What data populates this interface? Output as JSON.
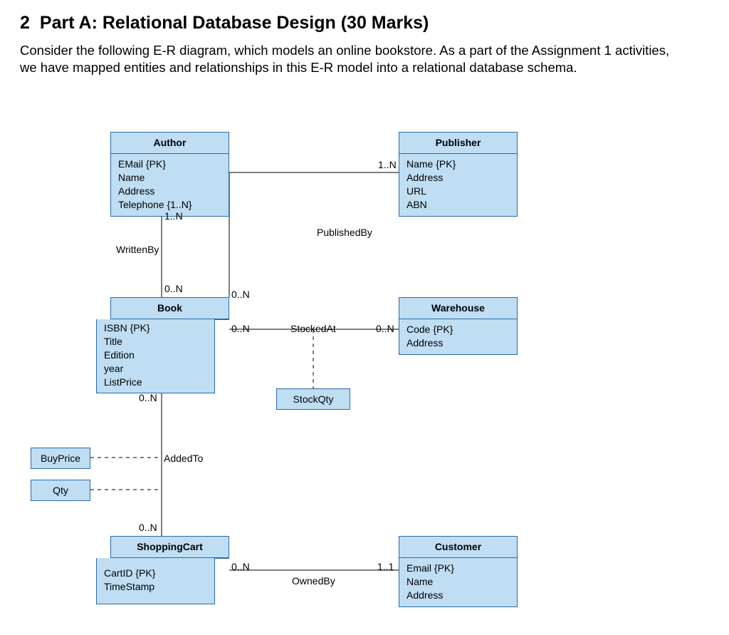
{
  "heading": {
    "number": "2",
    "title": "Part A: Relational Database Design (30 Marks)"
  },
  "intro": "Consider the following E-R diagram, which models an online bookstore. As a part of the Assignment 1 activities, we have mapped entities and relationships in this E-R model into a relational database schema.",
  "entities": {
    "author": {
      "name": "Author",
      "attrs": [
        "EMail {PK}",
        "Name",
        "Address",
        "Telephone {1..N}"
      ]
    },
    "publisher": {
      "name": "Publisher",
      "attrs": [
        "Name {PK}",
        "Address",
        "URL",
        "ABN"
      ]
    },
    "book": {
      "name": "Book",
      "attrs": [
        "ISBN {PK}",
        "Title",
        "Edition",
        "year",
        "ListPrice"
      ]
    },
    "warehouse": {
      "name": "Warehouse",
      "attrs": [
        "Code {PK}",
        "Address"
      ]
    },
    "cart": {
      "name": "ShoppingCart",
      "attrs": [
        "CartID {PK}",
        "TimeStamp"
      ]
    },
    "customer": {
      "name": "Customer",
      "attrs": [
        "Email {PK}",
        "Name",
        "Address"
      ]
    }
  },
  "relationships": {
    "writtenBy": "WrittenBy",
    "publishedBy": "PublishedBy",
    "stockedAt": "StockedAt",
    "stockQty": "StockQty",
    "addedTo": "AddedTo",
    "ownedBy": "OwnedBy"
  },
  "attributeBoxes": {
    "buyPrice": "BuyPrice",
    "qty": "Qty"
  },
  "cardinalities": {
    "author_bottom": "1..N",
    "book_top": "0..N",
    "book_right_top": "0..N",
    "book_right_mid": "0..N",
    "book_bottom": "0..N",
    "publisher_left": "1..N",
    "warehouse_left": "0..N",
    "cart_top": "0..N",
    "cart_right": "0..N",
    "customer_left": "1..1"
  }
}
